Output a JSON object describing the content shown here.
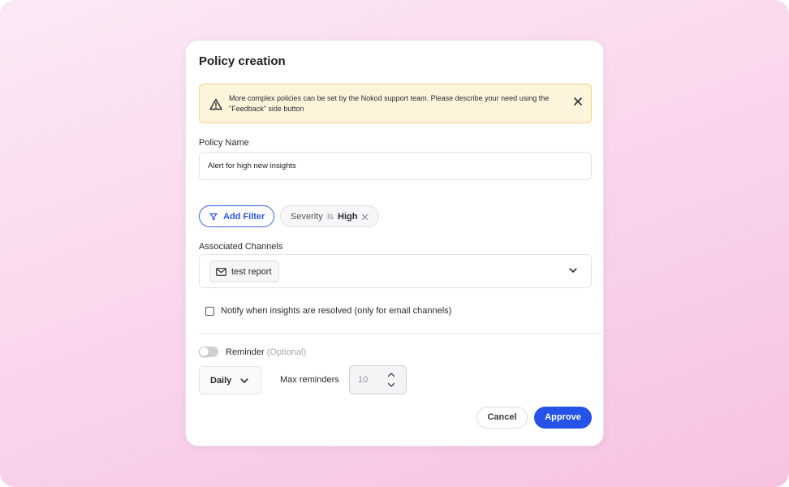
{
  "dialog": {
    "title": "Policy creation"
  },
  "alert": {
    "icon": "warning-icon",
    "message": "More complex policies can be set by the Nokod support team. Please describe your need using the \"Feedback\" side button",
    "close_icon": "close-icon"
  },
  "policy_name": {
    "label": "Policy Name",
    "value": "Alert for high new insights"
  },
  "filters": {
    "add_label": "Add Filter",
    "add_icon": "filter-icon",
    "applied": [
      {
        "key": "Severity",
        "operator": "is",
        "value": "High"
      }
    ]
  },
  "channels": {
    "label": "Associated Channels",
    "selected": [
      {
        "icon": "mail-icon",
        "name": "test report"
      }
    ]
  },
  "notify_resolved": {
    "label": "Notify when insights are resolved (only for email channels)",
    "checked": false
  },
  "reminder": {
    "label": "Reminder",
    "optional_label": "(Optional)",
    "enabled": false,
    "frequency": "Daily",
    "max_label": "Max reminders",
    "max_value": "10"
  },
  "actions": {
    "cancel_label": "Cancel",
    "approve_label": "Approve"
  },
  "colors": {
    "primary": "#2553ea",
    "alert_bg": "#fdf4dc",
    "alert_border": "#f1d48a",
    "backdrop": "#f9d3ec"
  }
}
